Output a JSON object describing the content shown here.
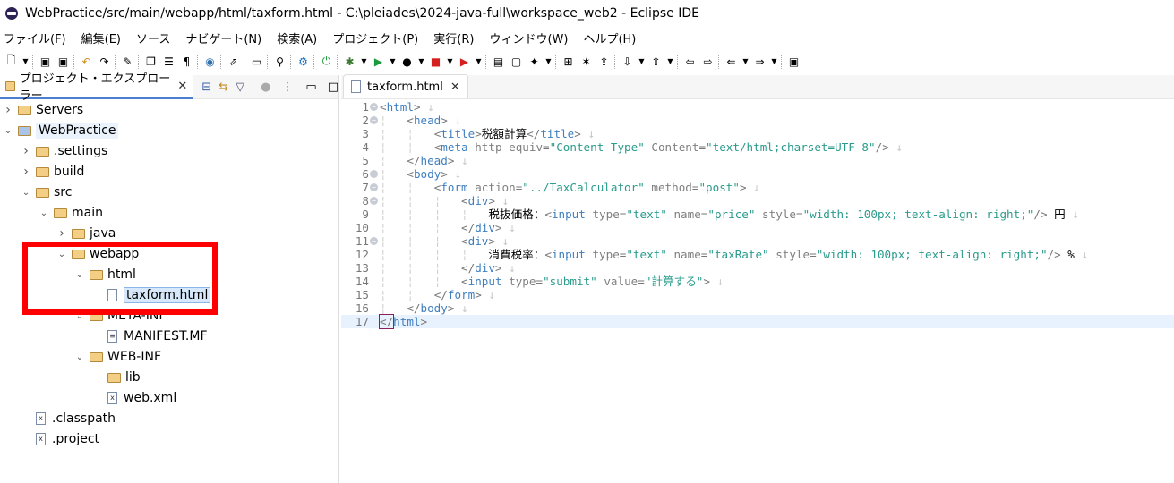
{
  "window": {
    "title": "WebPractice/src/main/webapp/html/taxform.html - C:\\pleiades\\2024-java-full\\workspace_web2 - Eclipse IDE"
  },
  "menu": [
    "ファイル(F)",
    "編集(E)",
    "ソース",
    "ナビゲート(N)",
    "検索(A)",
    "プロジェクト(P)",
    "実行(R)",
    "ウィンドウ(W)",
    "ヘルプ(H)"
  ],
  "toolbar_icons": [
    "new",
    "dd",
    "sep",
    "save",
    "save-all",
    "sep",
    "undo",
    "redo",
    "sep",
    "highlight",
    "sep",
    "copy",
    "list",
    "pilcrow",
    "sep",
    "globe",
    "sep",
    "deploy",
    "sep",
    "monitor",
    "sep",
    "link",
    "sep",
    "gear",
    "sep",
    "power",
    "sep",
    "debug",
    "dd",
    "run",
    "dd",
    "coverage",
    "dd",
    "stop",
    "dd",
    "external",
    "dd",
    "sep",
    "open-folder",
    "folder",
    "wand",
    "dd",
    "sep",
    "expand",
    "star",
    "export",
    "sep",
    "next-anno",
    "dd",
    "prev-anno",
    "dd",
    "sep",
    "back",
    "forward",
    "sep",
    "prev",
    "dd",
    "next",
    "dd",
    "sep",
    "pin"
  ],
  "explorer": {
    "tab_label": "プロジェクト・エクスプローラー",
    "tree": [
      {
        "label": "Servers",
        "depth": 0,
        "kind": "folder",
        "expanded": false
      },
      {
        "label": "WebPractice",
        "depth": 0,
        "kind": "project",
        "expanded": true
      },
      {
        "label": ".settings",
        "depth": 1,
        "kind": "folder",
        "expanded": false
      },
      {
        "label": "build",
        "depth": 1,
        "kind": "folder",
        "expanded": false
      },
      {
        "label": "src",
        "depth": 1,
        "kind": "folder",
        "expanded": true
      },
      {
        "label": "main",
        "depth": 2,
        "kind": "folder",
        "expanded": true
      },
      {
        "label": "java",
        "depth": 3,
        "kind": "folder",
        "expanded": false
      },
      {
        "label": "webapp",
        "depth": 3,
        "kind": "folder",
        "expanded": true
      },
      {
        "label": "html",
        "depth": 4,
        "kind": "folder",
        "expanded": true
      },
      {
        "label": "taxform.html",
        "depth": 5,
        "kind": "html",
        "selected": true
      },
      {
        "label": "META-INF",
        "depth": 4,
        "kind": "folder",
        "expanded": true
      },
      {
        "label": "MANIFEST.MF",
        "depth": 5,
        "kind": "text"
      },
      {
        "label": "WEB-INF",
        "depth": 4,
        "kind": "folder",
        "expanded": true
      },
      {
        "label": "lib",
        "depth": 5,
        "kind": "folder"
      },
      {
        "label": "web.xml",
        "depth": 5,
        "kind": "xml"
      },
      {
        "label": ".classpath",
        "depth": 1,
        "kind": "xml"
      },
      {
        "label": ".project",
        "depth": 1,
        "kind": "xml"
      }
    ]
  },
  "editor": {
    "tab_label": "taxform.html",
    "current_line": 17,
    "lines": [
      {
        "n": 1,
        "fold": true,
        "ind": 0,
        "t": [
          [
            "br",
            "<"
          ],
          [
            "tag",
            "html"
          ],
          [
            "br",
            ">"
          ]
        ]
      },
      {
        "n": 2,
        "fold": true,
        "ind": 1,
        "t": [
          [
            "br",
            "<"
          ],
          [
            "tag",
            "head"
          ],
          [
            "br",
            ">"
          ]
        ]
      },
      {
        "n": 3,
        "ind": 2,
        "t": [
          [
            "br",
            "<"
          ],
          [
            "tag",
            "title"
          ],
          [
            "br",
            ">"
          ],
          [
            "txt",
            "税額計算"
          ],
          [
            "br",
            "</"
          ],
          [
            "tag",
            "title"
          ],
          [
            "br",
            ">"
          ]
        ]
      },
      {
        "n": 4,
        "ind": 2,
        "t": [
          [
            "br",
            "<"
          ],
          [
            "tag",
            "meta"
          ],
          [
            "attr",
            " http-equiv"
          ],
          [
            "br",
            "="
          ],
          [
            "val",
            "\"Content-Type\""
          ],
          [
            "attr",
            " Content"
          ],
          [
            "br",
            "="
          ],
          [
            "val",
            "\"text/html;charset=UTF-8\""
          ],
          [
            "br",
            "/>"
          ]
        ]
      },
      {
        "n": 5,
        "ind": 1,
        "t": [
          [
            "br",
            "</"
          ],
          [
            "tag",
            "head"
          ],
          [
            "br",
            ">"
          ]
        ]
      },
      {
        "n": 6,
        "fold": true,
        "ind": 1,
        "t": [
          [
            "br",
            "<"
          ],
          [
            "tag",
            "body"
          ],
          [
            "br",
            ">"
          ]
        ]
      },
      {
        "n": 7,
        "fold": true,
        "ind": 2,
        "t": [
          [
            "br",
            "<"
          ],
          [
            "tag",
            "form"
          ],
          [
            "attr",
            " action"
          ],
          [
            "br",
            "="
          ],
          [
            "val",
            "\"../TaxCalculator\""
          ],
          [
            "attr",
            " method"
          ],
          [
            "br",
            "="
          ],
          [
            "val",
            "\"post\""
          ],
          [
            "br",
            ">"
          ]
        ]
      },
      {
        "n": 8,
        "fold": true,
        "ind": 3,
        "t": [
          [
            "br",
            "<"
          ],
          [
            "tag",
            "div"
          ],
          [
            "br",
            ">"
          ]
        ]
      },
      {
        "n": 9,
        "ind": 4,
        "t": [
          [
            "txt",
            "税抜価格："
          ],
          [
            "br",
            "<"
          ],
          [
            "tag",
            "input"
          ],
          [
            "attr",
            " type"
          ],
          [
            "br",
            "="
          ],
          [
            "val",
            "\"text\""
          ],
          [
            "attr",
            " name"
          ],
          [
            "br",
            "="
          ],
          [
            "val",
            "\"price\""
          ],
          [
            "attr",
            " style"
          ],
          [
            "br",
            "="
          ],
          [
            "val",
            "\"width: 100px; text-align: right;\""
          ],
          [
            "br",
            "/>"
          ],
          [
            "txt",
            " 円"
          ]
        ]
      },
      {
        "n": 10,
        "ind": 3,
        "t": [
          [
            "br",
            "</"
          ],
          [
            "tag",
            "div"
          ],
          [
            "br",
            ">"
          ]
        ]
      },
      {
        "n": 11,
        "fold": true,
        "ind": 3,
        "t": [
          [
            "br",
            "<"
          ],
          [
            "tag",
            "div"
          ],
          [
            "br",
            ">"
          ]
        ]
      },
      {
        "n": 12,
        "ind": 4,
        "t": [
          [
            "txt",
            "消費税率："
          ],
          [
            "br",
            "<"
          ],
          [
            "tag",
            "input"
          ],
          [
            "attr",
            " type"
          ],
          [
            "br",
            "="
          ],
          [
            "val",
            "\"text\""
          ],
          [
            "attr",
            " name"
          ],
          [
            "br",
            "="
          ],
          [
            "val",
            "\"taxRate\""
          ],
          [
            "attr",
            " style"
          ],
          [
            "br",
            "="
          ],
          [
            "val",
            "\"width: 100px; text-align: right;\""
          ],
          [
            "br",
            "/>"
          ],
          [
            "txt",
            " %"
          ]
        ]
      },
      {
        "n": 13,
        "ind": 3,
        "t": [
          [
            "br",
            "</"
          ],
          [
            "tag",
            "div"
          ],
          [
            "br",
            ">"
          ]
        ]
      },
      {
        "n": 14,
        "ind": 3,
        "t": [
          [
            "br",
            "<"
          ],
          [
            "tag",
            "input"
          ],
          [
            "attr",
            " type"
          ],
          [
            "br",
            "="
          ],
          [
            "val",
            "\"submit\""
          ],
          [
            "attr",
            " value"
          ],
          [
            "br",
            "="
          ],
          [
            "val",
            "\"計算する\""
          ],
          [
            "br",
            ">"
          ]
        ]
      },
      {
        "n": 15,
        "ind": 2,
        "t": [
          [
            "br",
            "</"
          ],
          [
            "tag",
            "form"
          ],
          [
            "br",
            ">"
          ]
        ]
      },
      {
        "n": 16,
        "ind": 1,
        "t": [
          [
            "br",
            "</"
          ],
          [
            "tag",
            "body"
          ],
          [
            "br",
            ">"
          ]
        ]
      },
      {
        "n": 17,
        "ind": 0,
        "eol": false,
        "t": [
          [
            "br",
            "</"
          ],
          [
            "tag",
            "html"
          ],
          [
            "br",
            ">"
          ]
        ]
      }
    ]
  },
  "colors": {
    "highlight_box": "#ff0000",
    "selection": "#d6e8f9",
    "current_line": "#e8f2fe"
  }
}
